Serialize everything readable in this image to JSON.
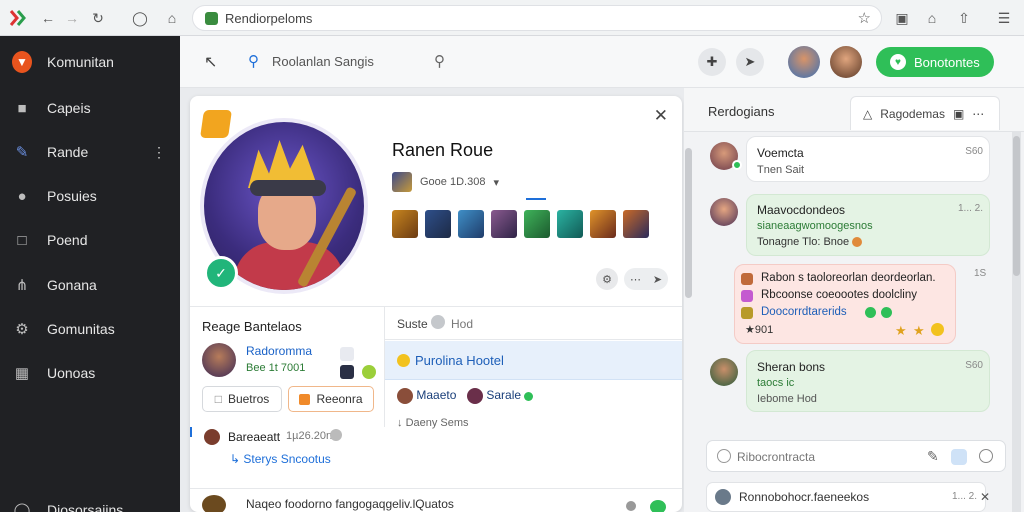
{
  "browser": {
    "url": "Rendiorpeloms"
  },
  "sidebar": {
    "items": [
      {
        "label": "Komunitan",
        "icon": "logo-icon"
      },
      {
        "label": "Capeis",
        "icon": "folder-icon"
      },
      {
        "label": "Rande",
        "icon": "edit-icon"
      },
      {
        "label": "Posuies",
        "icon": "user-icon"
      },
      {
        "label": "Poend",
        "icon": "chat-icon"
      },
      {
        "label": "Gonana",
        "icon": "network-icon"
      },
      {
        "label": "Gomunitas",
        "icon": "gear-icon"
      },
      {
        "label": "Uonoas",
        "icon": "grid-icon"
      },
      {
        "label": "Diosorsaiins",
        "icon": "help-icon"
      }
    ]
  },
  "topbar": {
    "search_placeholder": "Roolanlan Sangis",
    "cta_label": "Bonotontes"
  },
  "profile": {
    "name": "Ranen Roue",
    "rank": "Gooe 1D.308",
    "section_title": "Reage Bantelaos",
    "friend_name": "Radoromma",
    "friend_sub": "Bee 1t 7001",
    "btn_left": "Buetros",
    "btn_right": "Reeonra",
    "feed_name": "Bareaeatt",
    "feed_time": "1µ26.20n",
    "feed_sub": "Sterys Sncootus",
    "footer_text": "Naqeo foodorno fangogaqgeliv.lQuatos",
    "stats_label": "Suste",
    "stats_value": "Hod",
    "highlight": "Purolina Hootel",
    "player_a": "Maaeto",
    "player_b": "Sarale",
    "detail": "Daeny Sems"
  },
  "chat": {
    "title": "Rerdogians",
    "tab_label": "Ragodemas",
    "messages": [
      {
        "name": "Voemcta",
        "sub": "Tnen Sait",
        "time": "S60"
      },
      {
        "name": "Maavocdondeos",
        "sub1": "sianeaagwomoogesnos",
        "sub2": "Tonagne Tlo: Bnoe",
        "time": "1... 2."
      },
      {
        "line1": "Rabon s taoloreorlan deordeorlan.",
        "line2": "Rbcoonse coeoootes doolcliny",
        "line3": "Doocorrdtarerids",
        "line4": "★901",
        "time": "1S"
      },
      {
        "name": "Sheran bons",
        "sub1": "taocs ic",
        "sub2": "Iebome Hod",
        "time": "S60"
      }
    ],
    "input_placeholder": "Ribocrontracta",
    "last_item": "Ronnobohocr.faeneekos",
    "last_time": "1... 2."
  }
}
